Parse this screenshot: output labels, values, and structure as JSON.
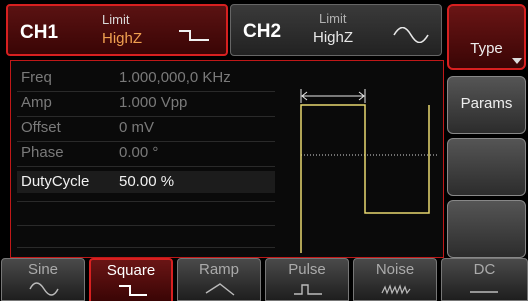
{
  "ch1": {
    "name": "CH1",
    "limit_label": "Limit",
    "load": "HighZ",
    "wave_icon": "square-wave-icon"
  },
  "ch2": {
    "name": "CH2",
    "limit_label": "Limit",
    "load": "HighZ",
    "wave_icon": "sine-wave-icon"
  },
  "softkeys": {
    "type": "Type",
    "params": "Params"
  },
  "params": [
    {
      "label": "Freq",
      "value": "1.000,000,0 KHz",
      "active": false
    },
    {
      "label": "Amp",
      "value": "1.000 Vpp",
      "active": false
    },
    {
      "label": "Offset",
      "value": "0 mV",
      "active": false
    },
    {
      "label": "Phase",
      "value": "0.00 °",
      "active": false
    },
    {
      "label": "DutyCycle",
      "value": "50.00 %",
      "active": true
    }
  ],
  "functions": [
    {
      "label": "Sine",
      "icon": "sine-wave-icon",
      "selected": false
    },
    {
      "label": "Square",
      "icon": "square-wave-icon",
      "selected": true
    },
    {
      "label": "Ramp",
      "icon": "ramp-wave-icon",
      "selected": false
    },
    {
      "label": "Pulse",
      "icon": "pulse-wave-icon",
      "selected": false
    },
    {
      "label": "Noise",
      "icon": "noise-wave-icon",
      "selected": false
    },
    {
      "label": "DC",
      "icon": "dc-icon",
      "selected": false
    }
  ],
  "colors": {
    "accent": "#d72020",
    "waveform": "#e8d870",
    "load_ch1": "#f0a050"
  }
}
